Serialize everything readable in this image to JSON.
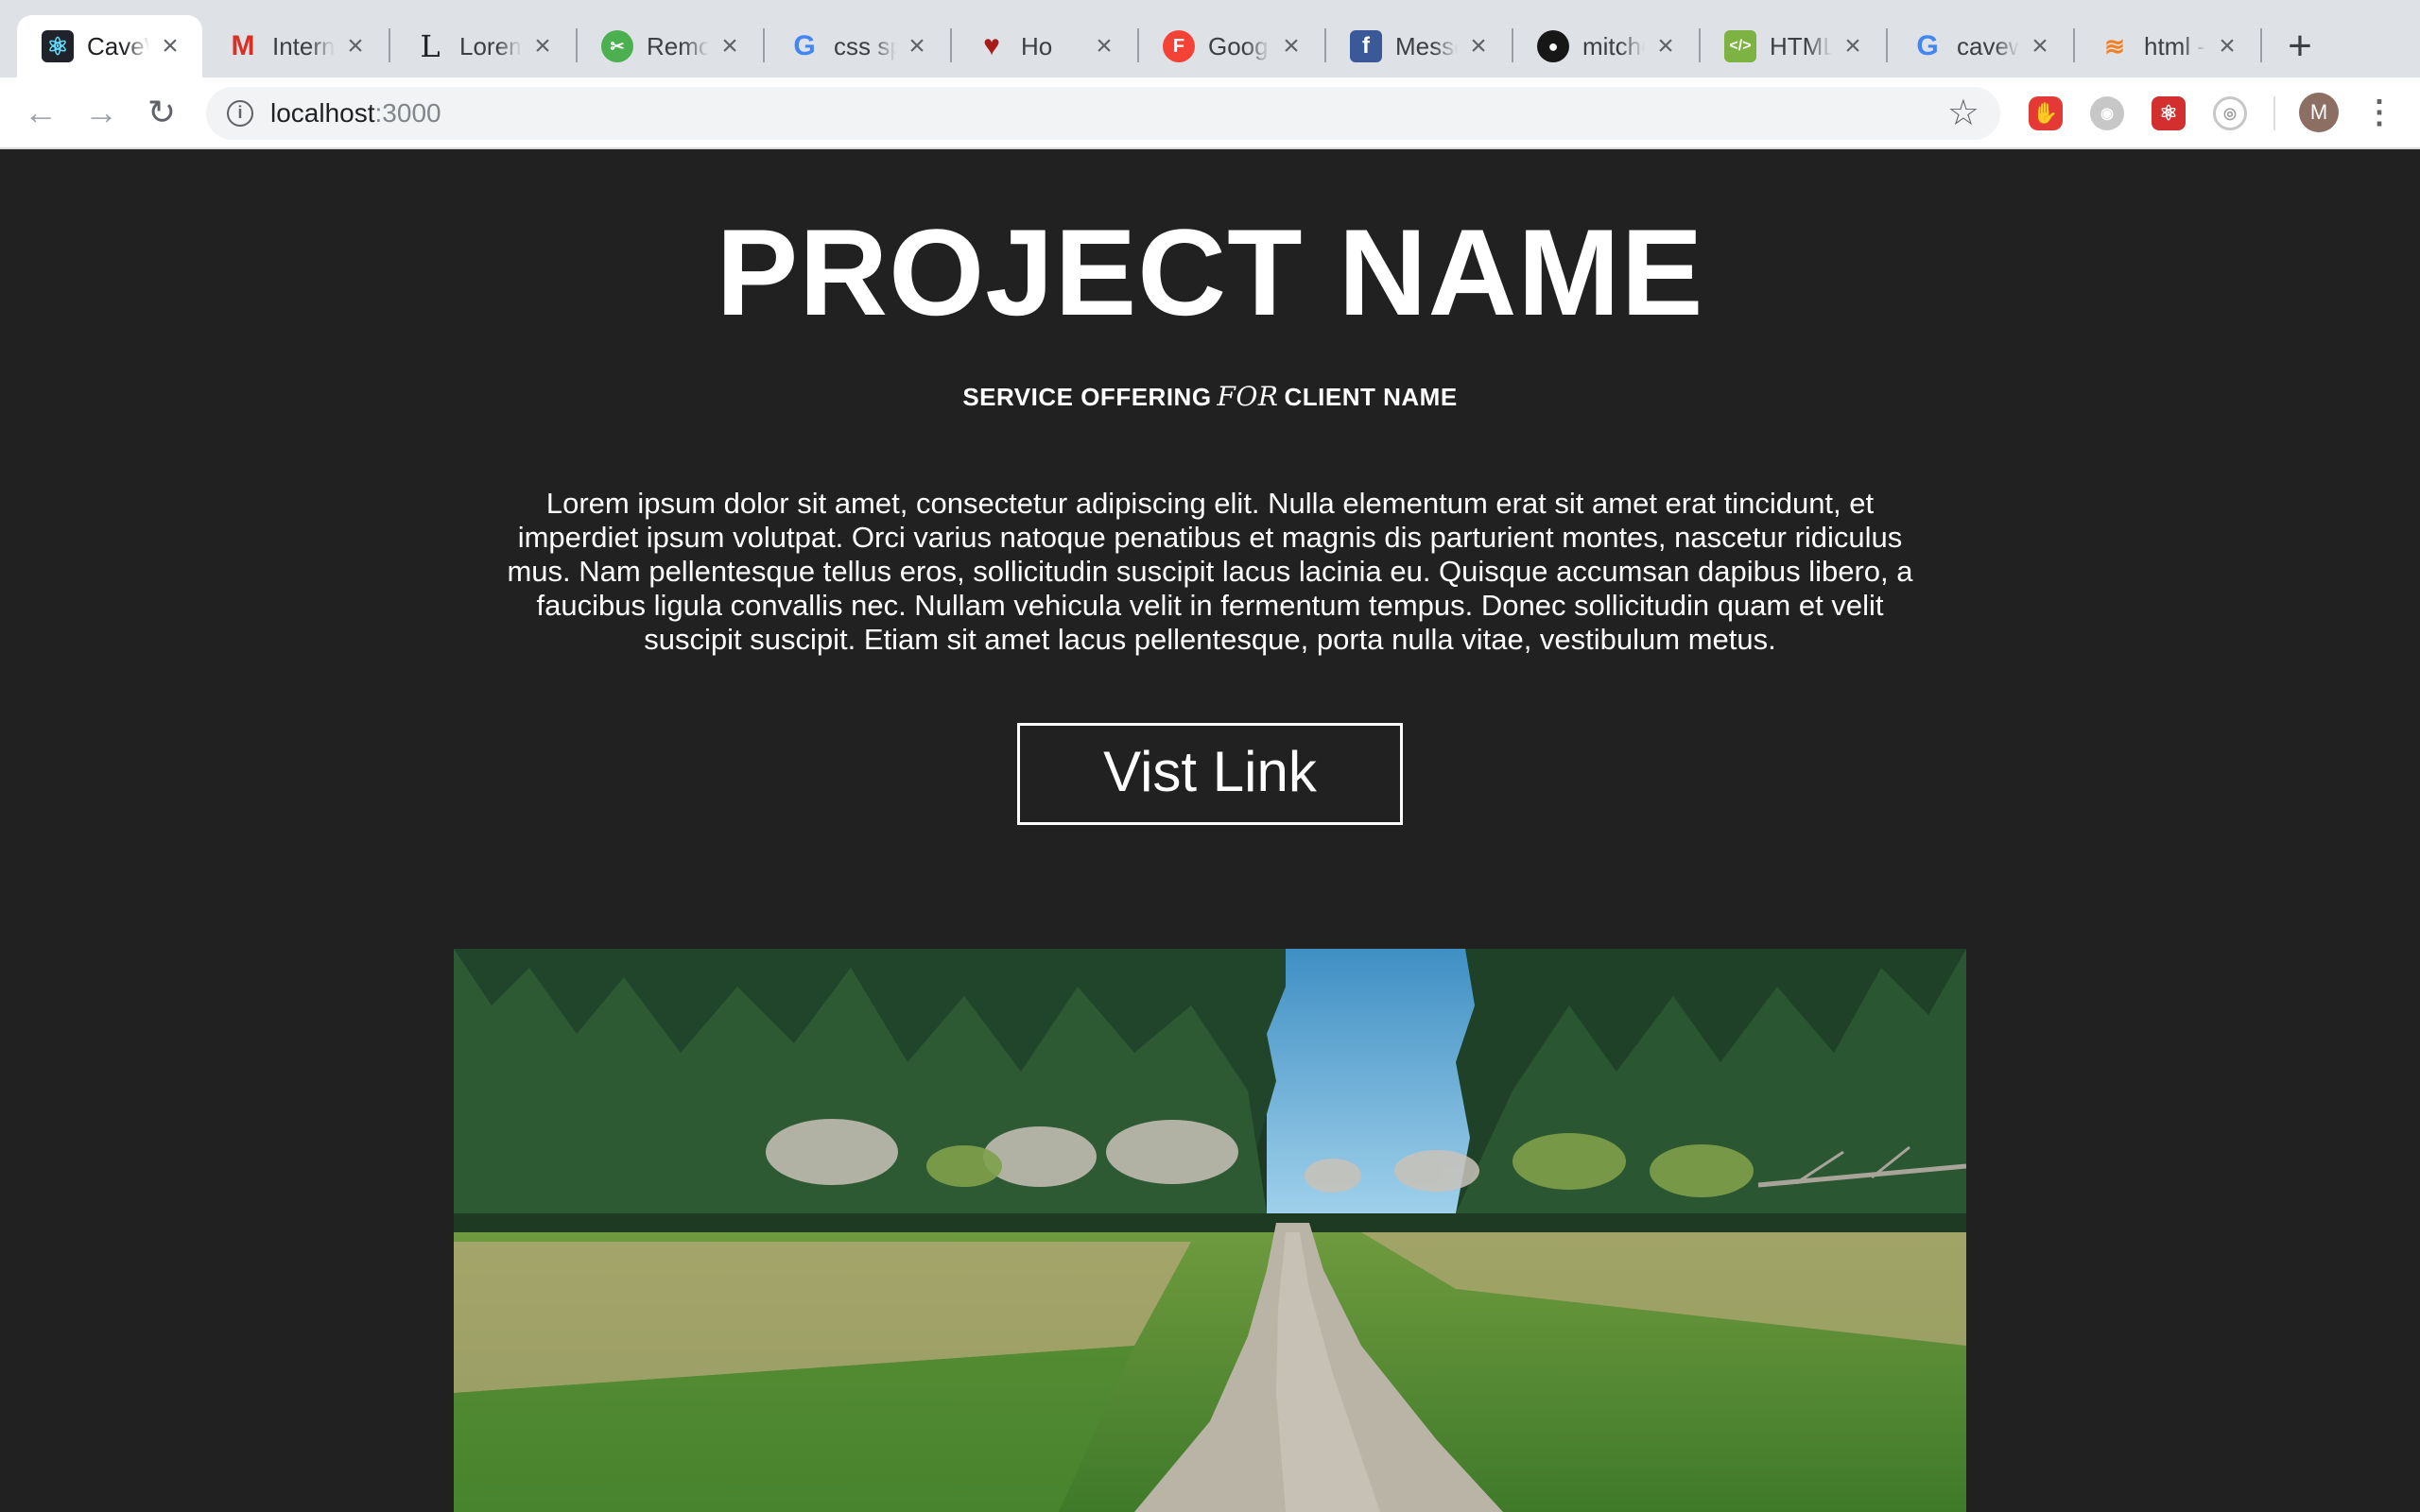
{
  "browser": {
    "tabs": [
      {
        "title": "CaveW",
        "icon": "react-icon",
        "active": true
      },
      {
        "title": "Interne",
        "icon": "gmail-icon"
      },
      {
        "title": "Lorem",
        "icon": "lorem-l-icon"
      },
      {
        "title": "Remov",
        "icon": "remove-bg-icon"
      },
      {
        "title": "css sp",
        "icon": "google-icon"
      },
      {
        "title": "Ho",
        "icon": "heart-icon"
      },
      {
        "title": "Googl",
        "icon": "google-fonts-icon"
      },
      {
        "title": "Messe",
        "icon": "facebook-icon"
      },
      {
        "title": "mitche",
        "icon": "github-icon"
      },
      {
        "title": "HTML",
        "icon": "html-icon"
      },
      {
        "title": "cavew",
        "icon": "google-icon"
      },
      {
        "title": "html -",
        "icon": "stackoverflow-icon"
      }
    ],
    "url_host": "localhost",
    "url_port": ":3000",
    "avatar_letter": "M",
    "extensions": [
      "adblock-icon",
      "discord-icon",
      "react-devtools-icon",
      "camera-icon"
    ]
  },
  "hero": {
    "title": "PROJECT NAME",
    "subtitle_pre": "SERVICE OFFERING",
    "subtitle_for": "FOR",
    "subtitle_post": "CLIENT NAME",
    "description": "Lorem ipsum dolor sit amet, consectetur adipiscing elit. Nulla elementum erat sit amet erat tincidunt, et imperdiet ipsum volutpat. Orci varius natoque penatibus et magnis dis parturient montes, nascetur ridiculus mus. Nam pellentesque tellus eros, sollicitudin suscipit lacus lacinia eu. Quisque accumsan dapibus libero, a faucibus ligula convallis nec. Nullam vehicula velit in fermentum tempus. Donec sollicitudin quam et velit suscipit suscipit. Etiam sit amet lacus pellentesque, porta nulla vitae, vestibulum metus.",
    "button_label": "Vist Link"
  },
  "colors": {
    "page_background": "#212121",
    "text": "#ffffff",
    "tabstrip": "#dee1e6"
  }
}
